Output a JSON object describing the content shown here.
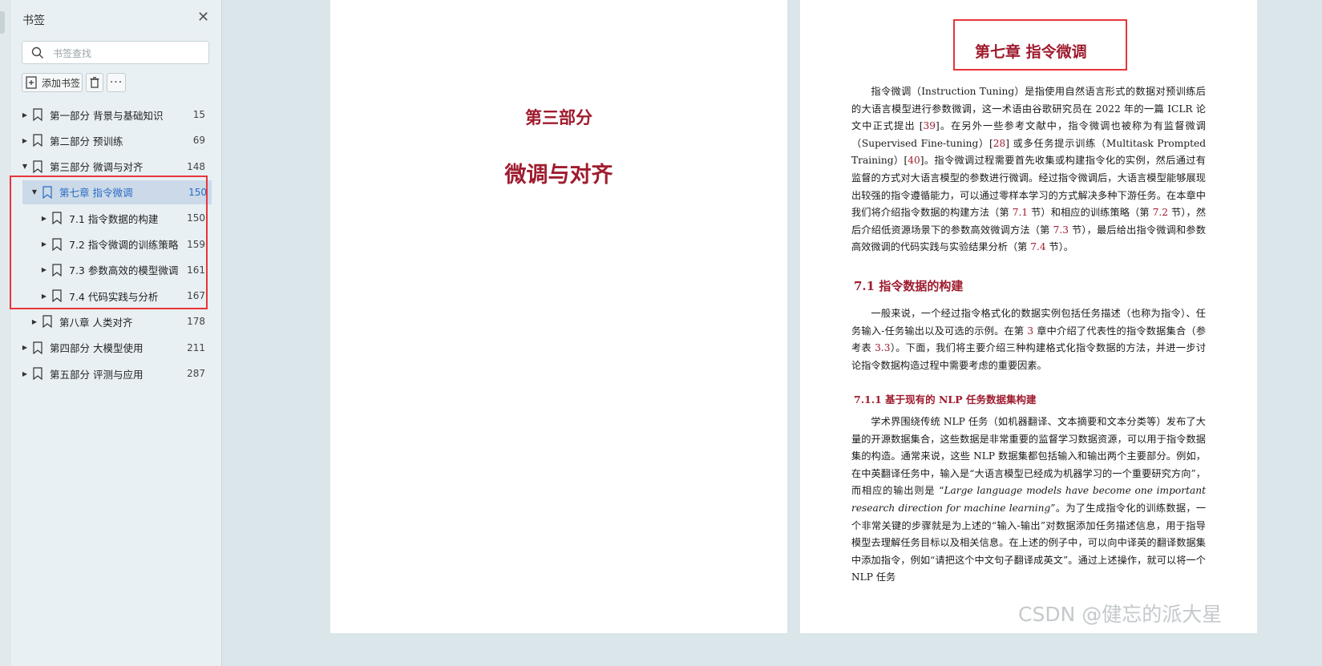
{
  "sidebar": {
    "title": "书签",
    "close_icon": "close-icon",
    "search_placeholder": "书签查找",
    "add_label": "添加书签",
    "more_label": "···",
    "items": [
      {
        "label": "第一部分 背景与基础知识",
        "page": "15",
        "expanded": false
      },
      {
        "label": "第二部分 预训练",
        "page": "69",
        "expanded": false
      },
      {
        "label": "第三部分 微调与对齐",
        "page": "148",
        "expanded": true
      },
      {
        "label": "第七章 指令微调",
        "page": "150",
        "expanded": true,
        "selected": true
      },
      {
        "label": "7.1 指令数据的构建",
        "page": "150",
        "expanded": false
      },
      {
        "label": "7.2 指令微调的训练策略",
        "page": "159",
        "expanded": false
      },
      {
        "label": "7.3 参数高效的模型微调",
        "page": "161",
        "expanded": false
      },
      {
        "label": "7.4 代码实践与分析",
        "page": "167",
        "expanded": false
      },
      {
        "label": "第八章 人类对齐",
        "page": "178",
        "expanded": false
      },
      {
        "label": "第四部分 大模型使用",
        "page": "211",
        "expanded": false
      },
      {
        "label": "第五部分 评测与应用",
        "page": "287",
        "expanded": false
      }
    ]
  },
  "page_left": {
    "part": "第三部分",
    "title": "微调与对齐"
  },
  "page_right": {
    "chapter_title": "第七章 指令微调",
    "intro": [
      {
        "t": "指令微调（Instruction Tuning）是指使用自然语言形式的数据对预训练后的大语言模型进行参数微调，这一术语由谷歌研究员在 2022 年的一篇 ICLR 论文中正式提出 ["
      },
      {
        "t": "39",
        "r": true
      },
      {
        "t": "]。在另外一些参考文献中，指令微调也被称为有监督微调（Supervised Fine-tuning）["
      },
      {
        "t": "28",
        "r": true
      },
      {
        "t": "] 或多任务提示训练（Multitask Prompted Training）["
      },
      {
        "t": "40",
        "r": true
      },
      {
        "t": "]。指令微调过程需要首先收集或构建指令化的实例，然后通过有监督的方式对大语言模型的参数进行微调。经过指令微调后，大语言模型能够展现出较强的指令遵循能力，可以通过零样本学习的方式解决多种下游任务。在本章中我们将介绍指令数据的构建方法（第 "
      },
      {
        "t": "7.1",
        "r": true
      },
      {
        "t": " 节）和相应的训练策略（第 "
      },
      {
        "t": "7.2",
        "r": true
      },
      {
        "t": " 节），然后介绍低资源场景下的参数高效微调方法（第 "
      },
      {
        "t": "7.3",
        "r": true
      },
      {
        "t": " 节），最后给出指令微调和参数高效微调的代码实践与实验结果分析（第 "
      },
      {
        "t": "7.4",
        "r": true
      },
      {
        "t": " 节）。"
      }
    ],
    "section_title": "7.1 指令数据的构建",
    "section_para": [
      {
        "t": "一般来说，一个经过指令格式化的数据实例包括任务描述（也称为指令）、任务输入-任务输出以及可选的示例。在第 "
      },
      {
        "t": "3",
        "r": true
      },
      {
        "t": " 章中介绍了代表性的指令数据集合（参考表 "
      },
      {
        "t": "3.3",
        "r": true
      },
      {
        "t": "）。下面，我们将主要介绍三种构建格式化指令数据的方法，并进一步讨论指令数据构造过程中需要考虑的重要因素。"
      }
    ],
    "subsection_title": "7.1.1 基于现有的 NLP 任务数据集构建",
    "subsection_para": [
      {
        "t": "学术界围绕传统 NLP 任务（如机器翻译、文本摘要和文本分类等）发布了大量的开源数据集合，这些数据是非常重要的监督学习数据资源，可以用于指令数据集的构造。通常来说，这些 NLP 数据集都包括输入和输出两个主要部分。例如，在中英翻译任务中，输入是“大语言模型已经成为机器学习的一个重要研究方向”，而相应的输出则是 “"
      },
      {
        "t": "Large language models have become one important research direction for machine learning",
        "i": true
      },
      {
        "t": "”。为了生成指令化的训练数据，一个非常关键的步骤就是为上述的“输入-输出”对数据添加任务描述信息，用于指导模型去理解任务目标以及相关信息。在上述的例子中，可以向中译英的翻译数据集中添加指令，例如“请把这个中文句子翻译成英文”。通过上述操作，就可以将一个 NLP 任务"
      }
    ]
  },
  "watermark": "CSDN @健忘的派大星",
  "colors": {
    "accent": "#9f1c2f",
    "selection": "#cbd9e8",
    "highlight_box": "#e8343b",
    "link": "#2b6cc4"
  }
}
